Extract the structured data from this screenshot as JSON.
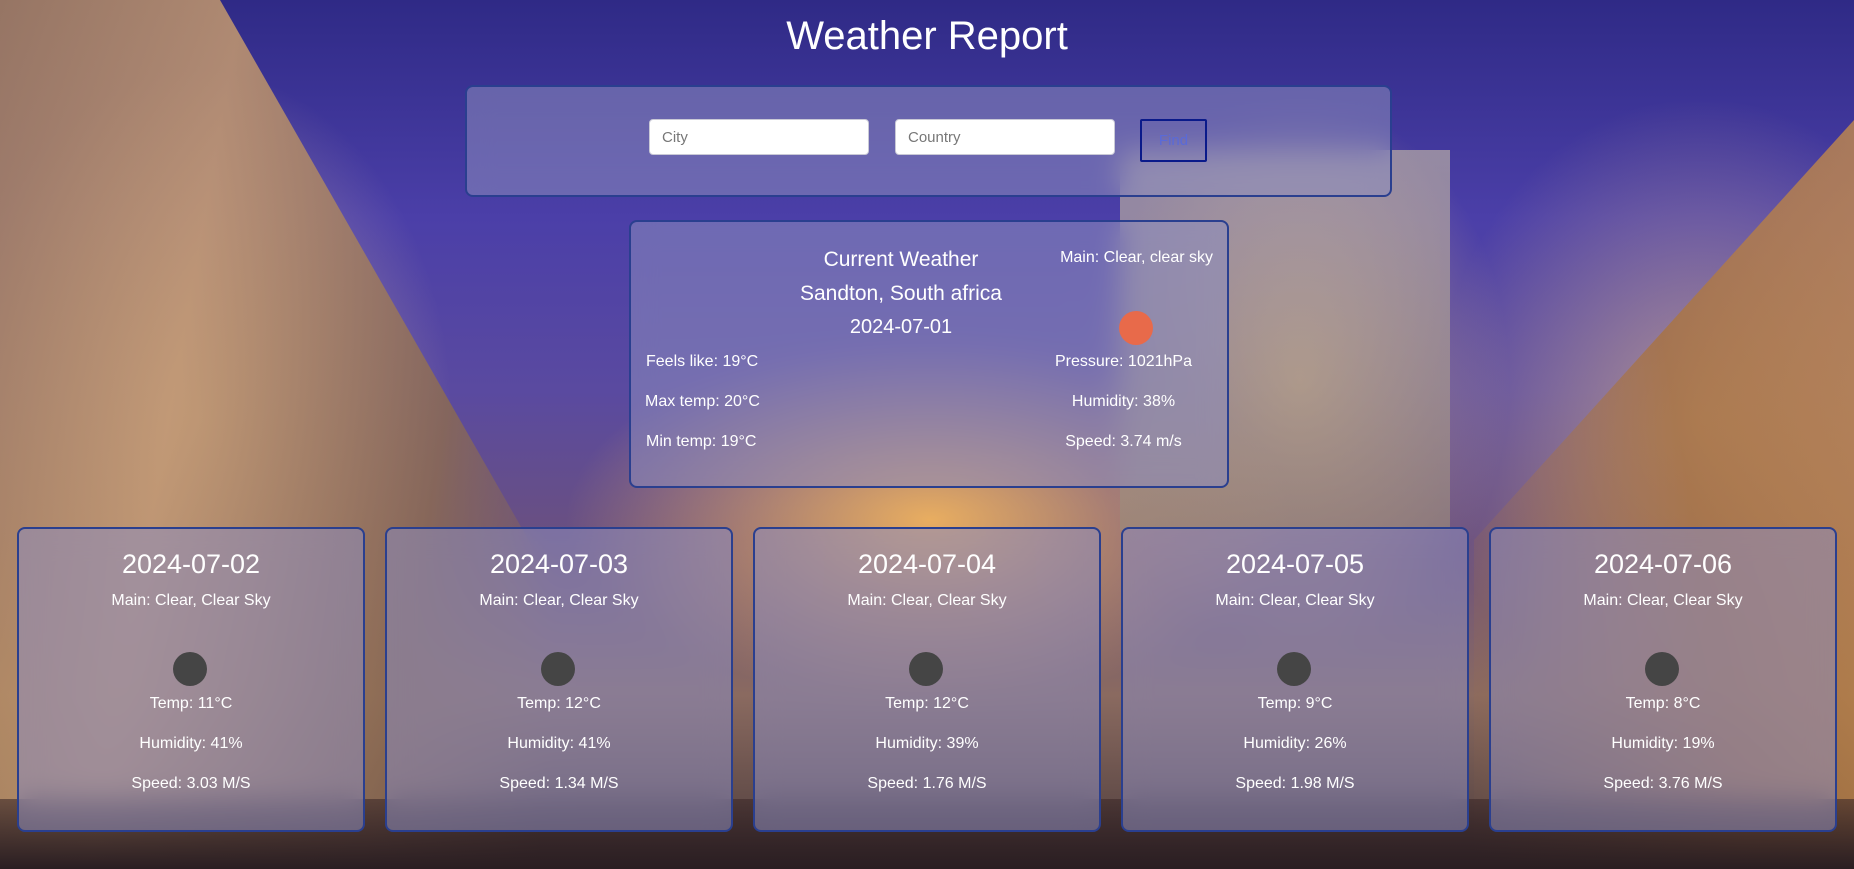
{
  "header": {
    "title": "Weather Report"
  },
  "search": {
    "city_placeholder": "City",
    "country_placeholder": "Country",
    "find_label": "Find"
  },
  "current": {
    "title": "Current Weather",
    "location": "Sandton, South africa",
    "date": "2024-07-01",
    "main": "Main: Clear, clear sky",
    "icon": "sun-icon",
    "feels_like": "Feels like: 19°C",
    "max_temp": "Max temp: 20°C",
    "min_temp": "Min temp: 19°C",
    "pressure": "Pressure: 1021hPa",
    "humidity": "Humidity: 38%",
    "speed": "Speed: 3.74 m/s"
  },
  "forecast": [
    {
      "date": "2024-07-02",
      "main": "Main: Clear, Clear Sky",
      "icon": "weather-icon",
      "temp": "Temp: 11°C",
      "humidity": "Humidity: 41%",
      "speed": "Speed: 3.03 M/S"
    },
    {
      "date": "2024-07-03",
      "main": "Main: Clear, Clear Sky",
      "icon": "weather-icon",
      "temp": "Temp: 12°C",
      "humidity": "Humidity: 41%",
      "speed": "Speed: 1.34 M/S"
    },
    {
      "date": "2024-07-04",
      "main": "Main: Clear, Clear Sky",
      "icon": "weather-icon",
      "temp": "Temp: 12°C",
      "humidity": "Humidity: 39%",
      "speed": "Speed: 1.76 M/S"
    },
    {
      "date": "2024-07-05",
      "main": "Main: Clear, Clear Sky",
      "icon": "weather-icon",
      "temp": "Temp: 9°C",
      "humidity": "Humidity: 26%",
      "speed": "Speed: 1.98 M/S"
    },
    {
      "date": "2024-07-06",
      "main": "Main: Clear, Clear Sky",
      "icon": "weather-icon",
      "temp": "Temp: 8°C",
      "humidity": "Humidity: 19%",
      "speed": "Speed: 3.76 M/S"
    }
  ],
  "colors": {
    "panel_border": "#2a3f8f",
    "find_border": "#0a1a8a",
    "current_icon": "#e86a4a",
    "forecast_icon": "#454545"
  }
}
